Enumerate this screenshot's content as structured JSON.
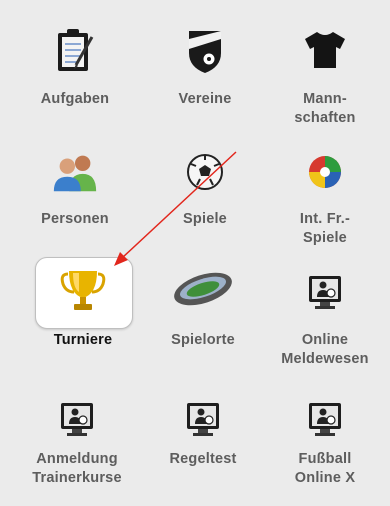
{
  "tiles": [
    {
      "label": "Aufgaben",
      "icon": "clipboard-icon"
    },
    {
      "label": "Vereine",
      "icon": "club-shield-icon"
    },
    {
      "label": "Mann-\nschaften",
      "icon": "jersey-icon"
    },
    {
      "label": "Personen",
      "icon": "people-icon"
    },
    {
      "label": "Spiele",
      "icon": "soccer-ball-icon"
    },
    {
      "label": "Int. Fr.-\nSpiele",
      "icon": "international-ball-icon"
    },
    {
      "label": "Turniere",
      "icon": "trophy-icon"
    },
    {
      "label": "Spielorte",
      "icon": "stadium-icon"
    },
    {
      "label": "Online\nMeldewesen",
      "icon": "monitor-user-icon"
    },
    {
      "label": "Anmeldung\nTrainerkurse",
      "icon": "monitor-user-icon"
    },
    {
      "label": "Regeltest",
      "icon": "monitor-user-icon"
    },
    {
      "label": "Fußball\nOnline X",
      "icon": "monitor-user-icon"
    }
  ],
  "colors": {
    "background": "#ebebeb",
    "label": "#5d5d5d",
    "active_label": "#111111",
    "annotation_arrow": "#e2261c",
    "trophy": "#e8b400"
  }
}
